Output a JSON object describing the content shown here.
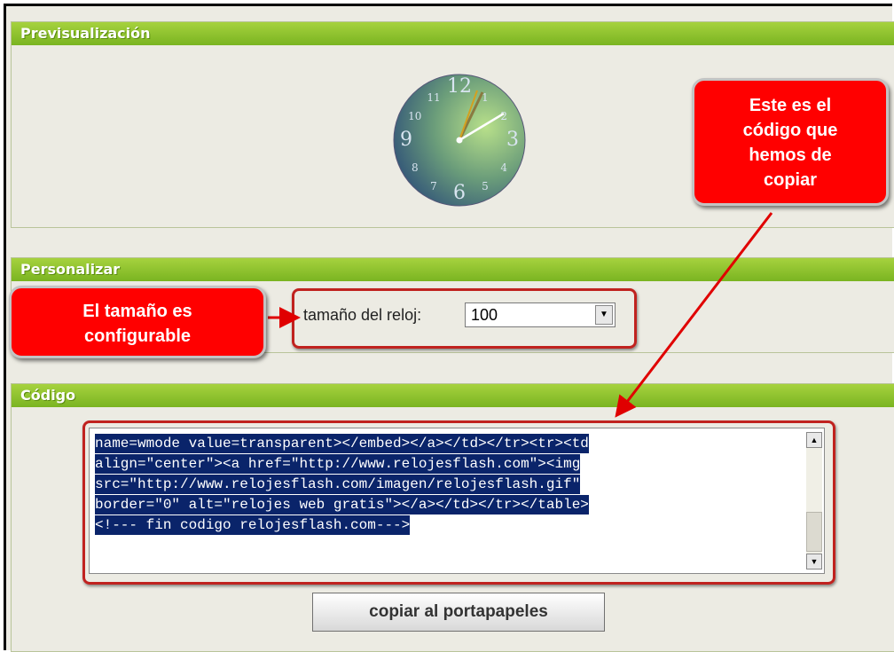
{
  "preview": {
    "header": "Previsualización",
    "clock_numbers": [
      "12",
      "1",
      "2",
      "3",
      "4",
      "5",
      "6",
      "7",
      "8",
      "9",
      "10",
      "11"
    ]
  },
  "personalize": {
    "header": "Personalizar",
    "size_label": "tamaño del reloj:",
    "size_value": "100"
  },
  "code": {
    "header": "Código",
    "lines": [
      "name=wmode value=transparent></embed></a></td></tr><tr><td",
      "align=\"center\"><a href=\"http://www.relojesflash.com\"><img",
      "src=\"http://www.relojesflash.com/imagen/relojesflash.gif\"",
      "border=\"0\" alt=\"relojes web gratis\"></a></td></tr></table>",
      "<!--- fin codigo relojesflash.com--->"
    ],
    "copy_button": "copiar al portapapeles"
  },
  "callouts": {
    "code_note": [
      "Este es el",
      "código que",
      "hemos de",
      "copiar"
    ],
    "size_note": [
      "El tamaño es",
      "configurable"
    ]
  },
  "colors": {
    "header_green": "#8cc334",
    "callout_red": "#ff0000",
    "highlight_border": "#c0221f",
    "selection_blue": "#0a246a"
  }
}
